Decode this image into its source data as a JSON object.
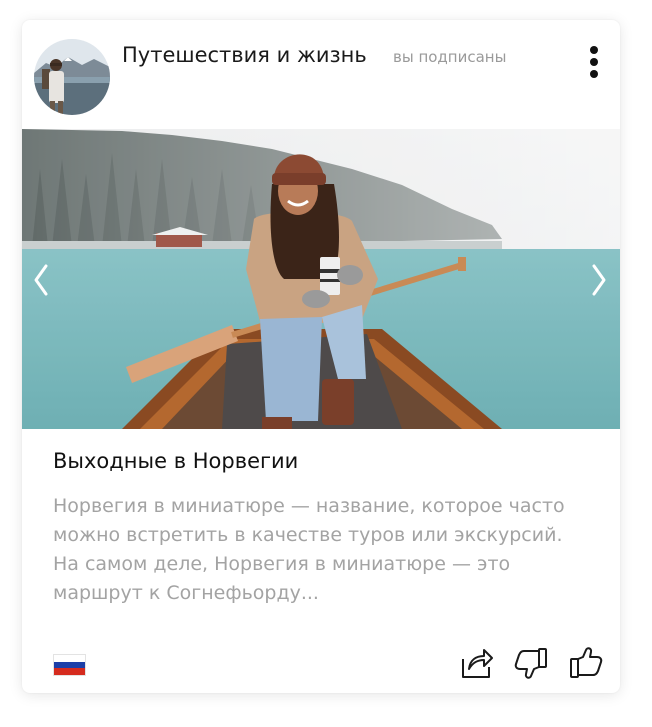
{
  "post": {
    "channel_name": "Путешествия и жизнь",
    "subscription_status": "вы подписаны",
    "title": "Выходные в Норвегии",
    "excerpt": "Норвегия в миниатюре — название, которое часто можно встретить в качестве туров или экскурсий. На самом деле, Норвегия в миниатюре — это маршрут к Согнефьорду..."
  },
  "icons": {
    "more": "more-vertical-icon",
    "prev": "chevron-left-icon",
    "next": "chevron-right-icon",
    "share": "share-icon",
    "dislike": "thumbs-down-icon",
    "like": "thumbs-up-icon",
    "flag": "russia-flag-icon"
  },
  "colors": {
    "text_primary": "#111111",
    "text_muted": "#a3a3a3",
    "flag_white": "#ffffff",
    "flag_blue": "#1c3fa8",
    "flag_red": "#d52b1e"
  }
}
